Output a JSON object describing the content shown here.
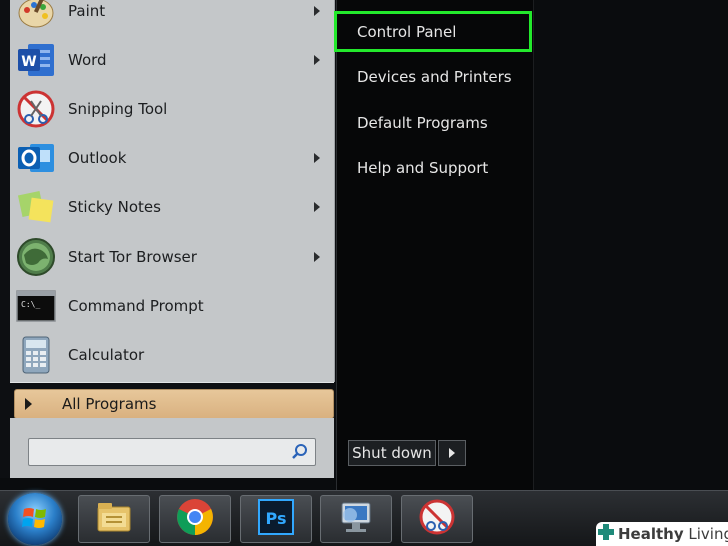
{
  "start_menu": {
    "programs": [
      {
        "label": "Paint",
        "icon": "paint-icon",
        "has_submenu": true
      },
      {
        "label": "Word",
        "icon": "word-icon",
        "has_submenu": true
      },
      {
        "label": "Snipping Tool",
        "icon": "snipping-tool-icon",
        "has_submenu": false
      },
      {
        "label": "Outlook",
        "icon": "outlook-icon",
        "has_submenu": true
      },
      {
        "label": "Sticky Notes",
        "icon": "sticky-notes-icon",
        "has_submenu": true
      },
      {
        "label": "Start Tor Browser",
        "icon": "tor-browser-icon",
        "has_submenu": true
      },
      {
        "label": "Command Prompt",
        "icon": "command-prompt-icon",
        "has_submenu": false
      },
      {
        "label": "Calculator",
        "icon": "calculator-icon",
        "has_submenu": false
      }
    ],
    "all_programs_label": "All Programs",
    "search_placeholder": "",
    "right_items": [
      {
        "label": "Control Panel",
        "highlighted": true
      },
      {
        "label": "Devices and Printers",
        "highlighted": false
      },
      {
        "label": "Default Programs",
        "highlighted": false
      },
      {
        "label": "Help and Support",
        "highlighted": false
      }
    ],
    "shutdown_label": "Shut down",
    "highlight_color": "#23e92c"
  },
  "taskbar": {
    "items": [
      "start-orb-icon",
      "file-explorer-icon",
      "chrome-icon",
      "photoshop-icon",
      "network-icon",
      "snipping-tool-icon"
    ],
    "photoshop_text": "Ps"
  },
  "watermark": {
    "brand_bold": "Healthy",
    "brand_rest": " Living"
  }
}
